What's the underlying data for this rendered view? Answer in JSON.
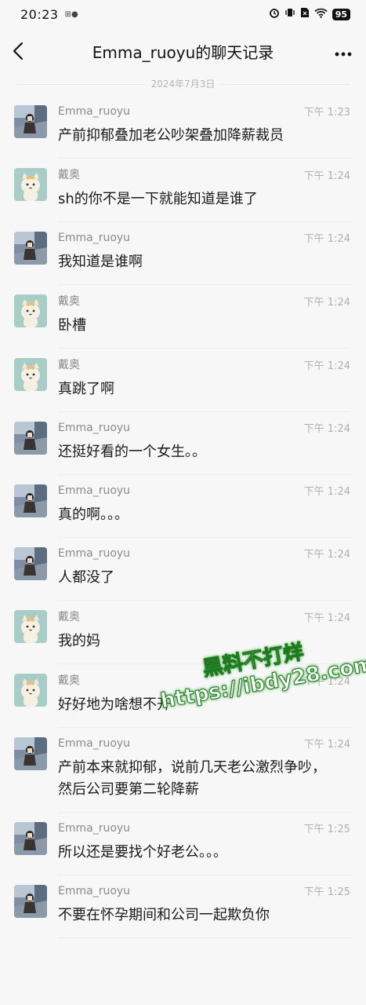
{
  "status_bar": {
    "time": "20:23",
    "notification": "⊞●",
    "icons": [
      "alarm-icon",
      "vibrate-icon",
      "sim-icon",
      "wifi-icon"
    ],
    "battery": "95"
  },
  "nav": {
    "title": "Emma_ruoyu的聊天记录"
  },
  "date_divider": "2024年7月3日",
  "messages": [
    {
      "sender": "Emma_ruoyu",
      "avatar": "photo",
      "time": "下午 1:23",
      "text": "产前抑郁叠加老公吵架叠加降薪裁员"
    },
    {
      "sender": "戴奥",
      "avatar": "cat",
      "time": "下午 1:24",
      "text": "sh的你不是一下就能知道是谁了"
    },
    {
      "sender": "Emma_ruoyu",
      "avatar": "photo",
      "time": "下午 1:24",
      "text": "我知道是谁啊"
    },
    {
      "sender": "戴奥",
      "avatar": "cat",
      "time": "下午 1:24",
      "text": "卧槽"
    },
    {
      "sender": "戴奥",
      "avatar": "cat",
      "time": "下午 1:24",
      "text": "真跳了啊"
    },
    {
      "sender": "Emma_ruoyu",
      "avatar": "photo",
      "time": "下午 1:24",
      "text": "还挺好看的一个女生。。"
    },
    {
      "sender": "Emma_ruoyu",
      "avatar": "photo",
      "time": "下午 1:24",
      "text": "真的啊。。。"
    },
    {
      "sender": "Emma_ruoyu",
      "avatar": "photo",
      "time": "下午 1:24",
      "text": "人都没了"
    },
    {
      "sender": "戴奥",
      "avatar": "cat",
      "time": "下午 1:24",
      "text": "我的妈"
    },
    {
      "sender": "戴奥",
      "avatar": "cat",
      "time": "下午 1:24",
      "text": "好好地为啥想不开"
    },
    {
      "sender": "Emma_ruoyu",
      "avatar": "photo",
      "time": "下午 1:24",
      "text": "产前本来就抑郁，说前几天老公激烈争吵，然后公司要第二轮降薪"
    },
    {
      "sender": "Emma_ruoyu",
      "avatar": "photo",
      "time": "下午 1:25",
      "text": "所以还是要找个好老公。。。"
    },
    {
      "sender": "Emma_ruoyu",
      "avatar": "photo",
      "time": "下午 1:25",
      "text": "不要在怀孕期间和公司一起欺负你"
    }
  ],
  "watermark": {
    "line1": "黑料不打烊",
    "line2": "https://ibdy28.com"
  }
}
